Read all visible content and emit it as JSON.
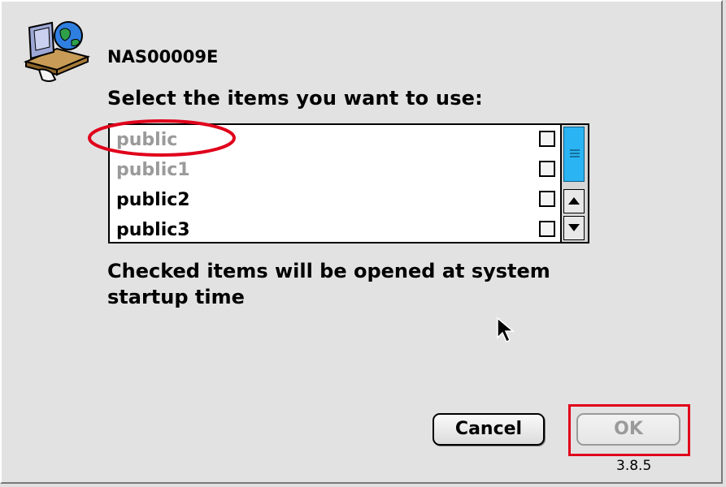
{
  "dialog": {
    "server_name": "NAS00009E",
    "prompt": "Select the items you want to use:",
    "footnote": "Checked items will be opened at system startup time",
    "version": "3.8.5"
  },
  "list": {
    "items": [
      {
        "label": "public",
        "enabled": false,
        "checked": false
      },
      {
        "label": "public1",
        "enabled": false,
        "checked": false
      },
      {
        "label": "public2",
        "enabled": true,
        "checked": false
      },
      {
        "label": "public3",
        "enabled": true,
        "checked": false
      }
    ]
  },
  "buttons": {
    "cancel": "Cancel",
    "ok": "OK"
  },
  "icons": {
    "server": "network-server-icon",
    "cursor": "arrow-cursor-icon",
    "scroll_up": "arrow-up-icon",
    "scroll_down": "arrow-down-icon"
  },
  "colors": {
    "scroll_thumb": "#2ab4f3",
    "annotation": "#e0001b",
    "disabled_text": "#9a9a9a"
  }
}
